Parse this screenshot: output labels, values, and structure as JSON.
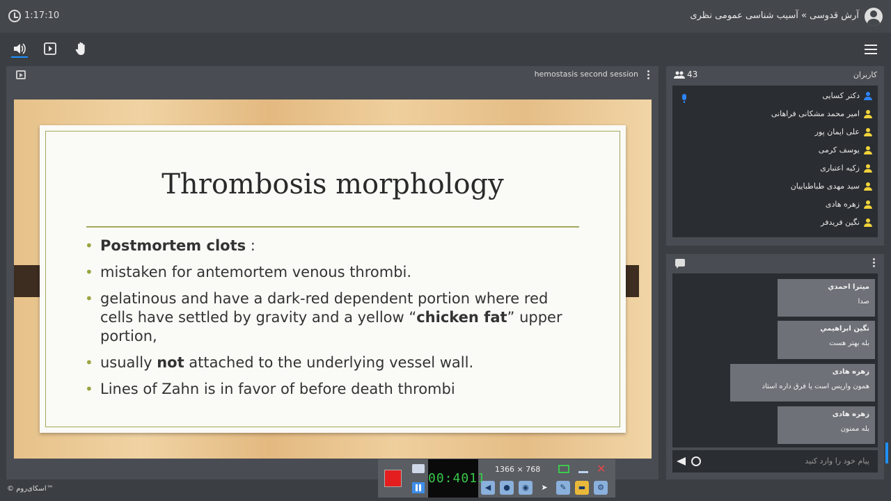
{
  "header": {
    "time": "1:17:10",
    "title": "آرش قدوسی » آسیب شناسی عمومی نظری"
  },
  "toolbar": {
    "audio_icon": "speaker-icon",
    "share_icon": "play-screen-icon",
    "hand_icon": "raise-hand-icon",
    "menu_icon": "hamburger-menu-icon"
  },
  "presentation": {
    "session_name": "hemostasis second session",
    "slide": {
      "title": "Thrombosis morphology",
      "bullets": [
        {
          "bold": "Postmortem clots",
          "text": " :"
        },
        {
          "text": " mistaken for antemortem venous thrombi."
        },
        {
          "text_before": " gelatinous and have a dark-red dependent portion where red cells have settled by gravity and a yellow “",
          "bold": "chicken fat",
          "text_after": "” upper portion,"
        },
        {
          "text_before": " usually ",
          "bold": "not",
          "text_after": " attached to the underlying vessel wall."
        },
        {
          "text": "Lines of Zahn is in favor of before death thrombi"
        }
      ]
    }
  },
  "users": {
    "title": "کاربران",
    "count": "43",
    "list": [
      {
        "name": "دکتر کسایی",
        "color": "#2d84f7",
        "speaking": true
      },
      {
        "name": "امیر محمد مشکانی فراهانی",
        "color": "#f1d33b"
      },
      {
        "name": "علی ایمان پور",
        "color": "#f1d33b"
      },
      {
        "name": "یوسف کرمی",
        "color": "#f1d33b"
      },
      {
        "name": "زکیه اعتباری",
        "color": "#f1d33b"
      },
      {
        "name": "سید مهدی طباطباییان",
        "color": "#f1d33b"
      },
      {
        "name": "زهره هادی",
        "color": "#f1d33b"
      },
      {
        "name": "نگین فریدفر",
        "color": "#f1d33b"
      }
    ]
  },
  "chat": {
    "messages": [
      {
        "sender": "ميترا احمدي",
        "text": "صدا"
      },
      {
        "sender": "نگین ابراهیمي",
        "text": "بله بهتر هست"
      },
      {
        "sender": "زهره هادی",
        "text": "همون واریس است یا فرق داره استاد"
      },
      {
        "sender": "زهره هادی",
        "text": "بله ممنون"
      }
    ],
    "placeholder": "پیام خود را وارد کنید"
  },
  "recorder": {
    "timer": "00:4011",
    "resolution": "1366 × 768"
  },
  "footer": {
    "brand": "© اسکای‌روم™"
  }
}
